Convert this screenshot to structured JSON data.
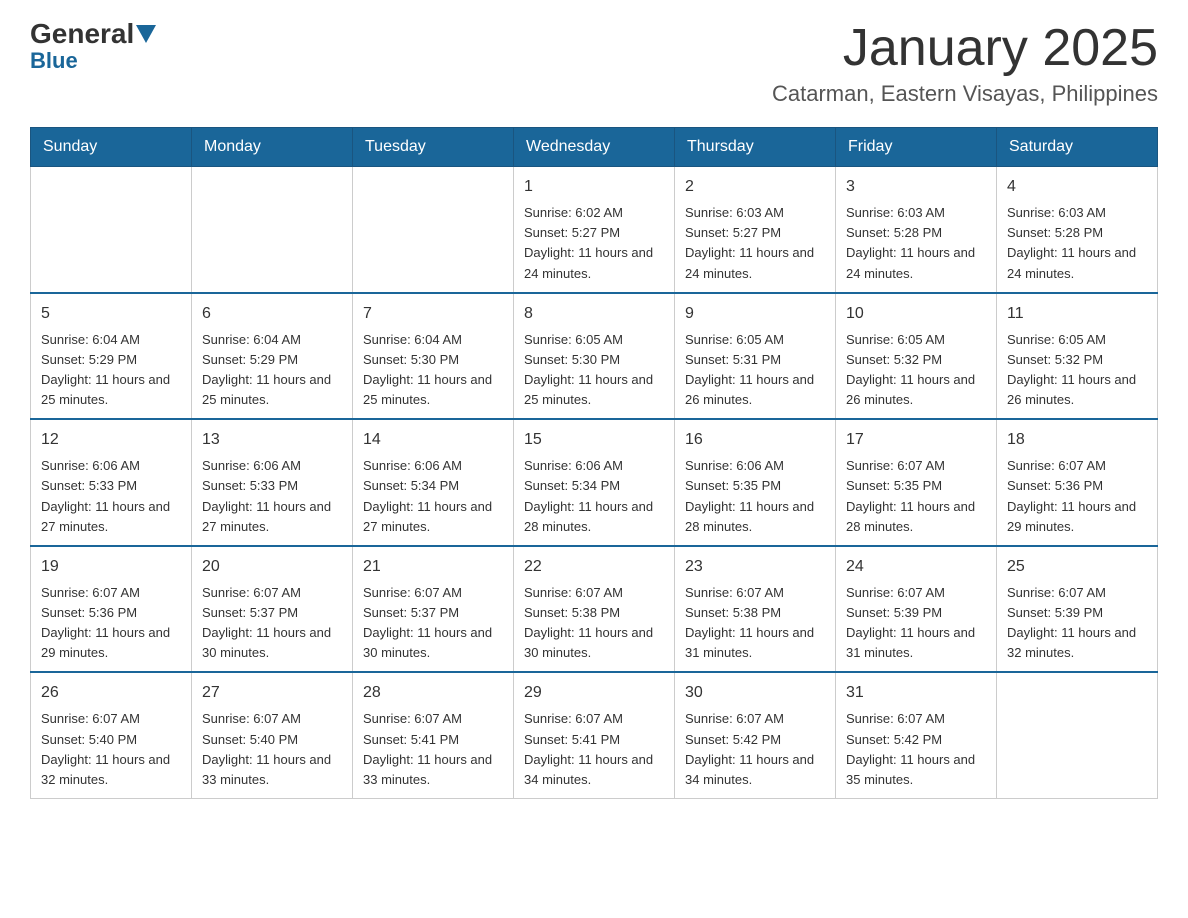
{
  "header": {
    "logo_general": "General",
    "logo_blue": "Blue",
    "title": "January 2025",
    "subtitle": "Catarman, Eastern Visayas, Philippines"
  },
  "weekdays": [
    "Sunday",
    "Monday",
    "Tuesday",
    "Wednesday",
    "Thursday",
    "Friday",
    "Saturday"
  ],
  "weeks": [
    {
      "days": [
        {
          "num": "",
          "info": ""
        },
        {
          "num": "",
          "info": ""
        },
        {
          "num": "",
          "info": ""
        },
        {
          "num": "1",
          "info": "Sunrise: 6:02 AM\nSunset: 5:27 PM\nDaylight: 11 hours\nand 24 minutes."
        },
        {
          "num": "2",
          "info": "Sunrise: 6:03 AM\nSunset: 5:27 PM\nDaylight: 11 hours\nand 24 minutes."
        },
        {
          "num": "3",
          "info": "Sunrise: 6:03 AM\nSunset: 5:28 PM\nDaylight: 11 hours\nand 24 minutes."
        },
        {
          "num": "4",
          "info": "Sunrise: 6:03 AM\nSunset: 5:28 PM\nDaylight: 11 hours\nand 24 minutes."
        }
      ]
    },
    {
      "days": [
        {
          "num": "5",
          "info": "Sunrise: 6:04 AM\nSunset: 5:29 PM\nDaylight: 11 hours\nand 25 minutes."
        },
        {
          "num": "6",
          "info": "Sunrise: 6:04 AM\nSunset: 5:29 PM\nDaylight: 11 hours\nand 25 minutes."
        },
        {
          "num": "7",
          "info": "Sunrise: 6:04 AM\nSunset: 5:30 PM\nDaylight: 11 hours\nand 25 minutes."
        },
        {
          "num": "8",
          "info": "Sunrise: 6:05 AM\nSunset: 5:30 PM\nDaylight: 11 hours\nand 25 minutes."
        },
        {
          "num": "9",
          "info": "Sunrise: 6:05 AM\nSunset: 5:31 PM\nDaylight: 11 hours\nand 26 minutes."
        },
        {
          "num": "10",
          "info": "Sunrise: 6:05 AM\nSunset: 5:32 PM\nDaylight: 11 hours\nand 26 minutes."
        },
        {
          "num": "11",
          "info": "Sunrise: 6:05 AM\nSunset: 5:32 PM\nDaylight: 11 hours\nand 26 minutes."
        }
      ]
    },
    {
      "days": [
        {
          "num": "12",
          "info": "Sunrise: 6:06 AM\nSunset: 5:33 PM\nDaylight: 11 hours\nand 27 minutes."
        },
        {
          "num": "13",
          "info": "Sunrise: 6:06 AM\nSunset: 5:33 PM\nDaylight: 11 hours\nand 27 minutes."
        },
        {
          "num": "14",
          "info": "Sunrise: 6:06 AM\nSunset: 5:34 PM\nDaylight: 11 hours\nand 27 minutes."
        },
        {
          "num": "15",
          "info": "Sunrise: 6:06 AM\nSunset: 5:34 PM\nDaylight: 11 hours\nand 28 minutes."
        },
        {
          "num": "16",
          "info": "Sunrise: 6:06 AM\nSunset: 5:35 PM\nDaylight: 11 hours\nand 28 minutes."
        },
        {
          "num": "17",
          "info": "Sunrise: 6:07 AM\nSunset: 5:35 PM\nDaylight: 11 hours\nand 28 minutes."
        },
        {
          "num": "18",
          "info": "Sunrise: 6:07 AM\nSunset: 5:36 PM\nDaylight: 11 hours\nand 29 minutes."
        }
      ]
    },
    {
      "days": [
        {
          "num": "19",
          "info": "Sunrise: 6:07 AM\nSunset: 5:36 PM\nDaylight: 11 hours\nand 29 minutes."
        },
        {
          "num": "20",
          "info": "Sunrise: 6:07 AM\nSunset: 5:37 PM\nDaylight: 11 hours\nand 30 minutes."
        },
        {
          "num": "21",
          "info": "Sunrise: 6:07 AM\nSunset: 5:37 PM\nDaylight: 11 hours\nand 30 minutes."
        },
        {
          "num": "22",
          "info": "Sunrise: 6:07 AM\nSunset: 5:38 PM\nDaylight: 11 hours\nand 30 minutes."
        },
        {
          "num": "23",
          "info": "Sunrise: 6:07 AM\nSunset: 5:38 PM\nDaylight: 11 hours\nand 31 minutes."
        },
        {
          "num": "24",
          "info": "Sunrise: 6:07 AM\nSunset: 5:39 PM\nDaylight: 11 hours\nand 31 minutes."
        },
        {
          "num": "25",
          "info": "Sunrise: 6:07 AM\nSunset: 5:39 PM\nDaylight: 11 hours\nand 32 minutes."
        }
      ]
    },
    {
      "days": [
        {
          "num": "26",
          "info": "Sunrise: 6:07 AM\nSunset: 5:40 PM\nDaylight: 11 hours\nand 32 minutes."
        },
        {
          "num": "27",
          "info": "Sunrise: 6:07 AM\nSunset: 5:40 PM\nDaylight: 11 hours\nand 33 minutes."
        },
        {
          "num": "28",
          "info": "Sunrise: 6:07 AM\nSunset: 5:41 PM\nDaylight: 11 hours\nand 33 minutes."
        },
        {
          "num": "29",
          "info": "Sunrise: 6:07 AM\nSunset: 5:41 PM\nDaylight: 11 hours\nand 34 minutes."
        },
        {
          "num": "30",
          "info": "Sunrise: 6:07 AM\nSunset: 5:42 PM\nDaylight: 11 hours\nand 34 minutes."
        },
        {
          "num": "31",
          "info": "Sunrise: 6:07 AM\nSunset: 5:42 PM\nDaylight: 11 hours\nand 35 minutes."
        },
        {
          "num": "",
          "info": ""
        }
      ]
    }
  ]
}
